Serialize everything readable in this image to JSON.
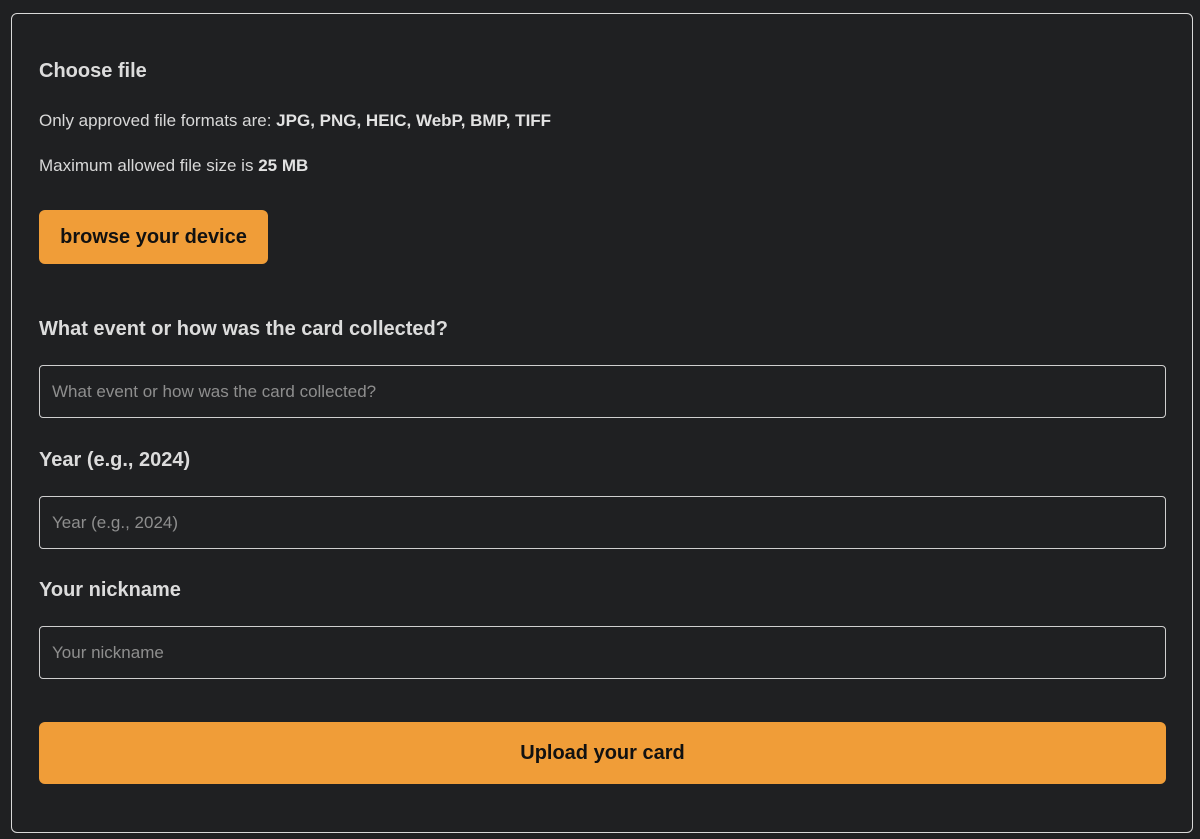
{
  "file_section": {
    "heading": "Choose file",
    "formats_prefix": "Only approved file formats are: ",
    "formats_list": "JPG, PNG, HEIC, WebP, BMP, TIFF",
    "size_prefix": "Maximum allowed file size is ",
    "size_value": "25 MB",
    "browse_label": "browse your device"
  },
  "event_field": {
    "label": "What event or how was the card collected?",
    "value": "",
    "placeholder": "What event or how was the card collected?"
  },
  "year_field": {
    "label": "Year (e.g., 2024)",
    "value": "",
    "placeholder": "Year (e.g., 2024)"
  },
  "nickname_field": {
    "label": "Your nickname",
    "value": "",
    "placeholder": "Your nickname"
  },
  "submit_label": "Upload your card",
  "colors": {
    "background": "#1f2022",
    "accent": "#f09d38",
    "border": "#d9d9d9",
    "text": "#dcdcdc",
    "placeholder": "#8e8e8e"
  }
}
